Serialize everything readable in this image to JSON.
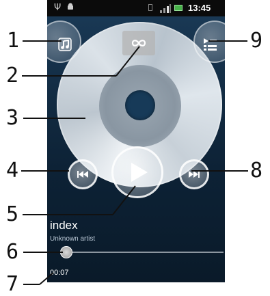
{
  "status_bar": {
    "time": "13:45",
    "icons": [
      "usb-icon",
      "android-icon",
      "sim-icon",
      "signal-icon",
      "battery-icon"
    ]
  },
  "player": {
    "track_title": "index",
    "artist": "Unknown artist",
    "elapsed": "00:07",
    "progress_fraction": 0.02,
    "buttons": [
      "music-library-button",
      "infinite-button",
      "queue-button",
      "previous-button",
      "play-button",
      "next-button"
    ]
  },
  "callouts": {
    "c1": "1",
    "c2": "2",
    "c3": "3",
    "c4": "4",
    "c5": "5",
    "c6": "6",
    "c7": "7",
    "c8": "8",
    "c9": "9"
  },
  "colors": {
    "background": "#0d2236",
    "accent": "#ffffff"
  }
}
